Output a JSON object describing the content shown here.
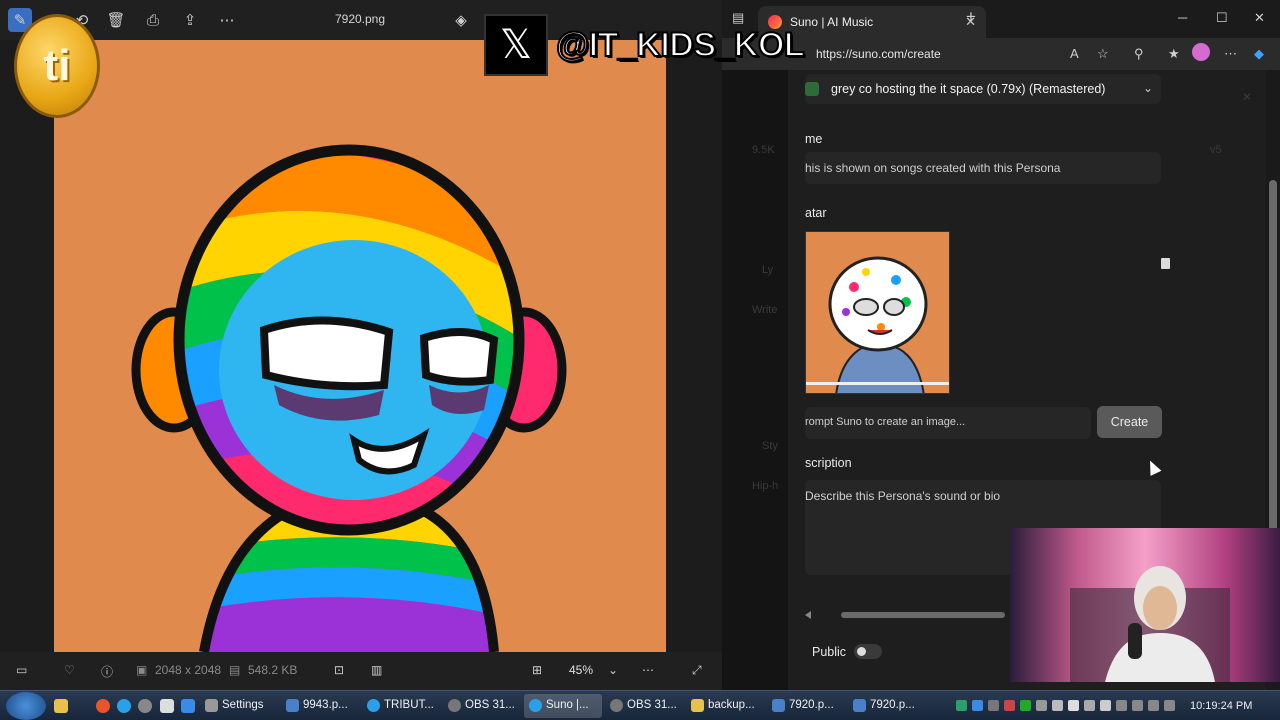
{
  "viewer": {
    "filename": "7920.png",
    "dimensions": "2048 x 2048",
    "filesize": "548.2 KB",
    "zoom": "45%",
    "toolbar_icons": [
      "edit-icon",
      "rotate-icon",
      "delete-icon",
      "print-icon",
      "share-icon",
      "more-icon"
    ]
  },
  "browser": {
    "tab_title": "Suno | AI Music",
    "url": "https://suno.com/create"
  },
  "persona_modal": {
    "song_select": "grey co hosting the it space (0.79x) (Remastered)",
    "name_label": "me",
    "name_placeholder": "his is shown on songs created with this Persona",
    "avatar_label": "atar",
    "image_prompt_placeholder": "rompt Suno to create an image...",
    "create_label": "Create",
    "description_label": "scription",
    "description_placeholder": "Describe this Persona's sound or bio",
    "public_label": "Public"
  },
  "background_page": {
    "count": "9.5K",
    "version": "v5",
    "lyrics_label": "Ly",
    "write_label": "Write",
    "style_label": "Sty",
    "hiphop_label": "Hip-h"
  },
  "overlay": {
    "handle": "@IT_KIDS_KOL",
    "coin_text": "ti"
  },
  "taskbar": {
    "tasks": [
      {
        "label": "Settings",
        "active": false
      },
      {
        "label": "9943.p...",
        "active": false
      },
      {
        "label": "TRIBUT...",
        "active": false
      },
      {
        "label": "OBS 31...",
        "active": false
      },
      {
        "label": "Suno |...",
        "active": true
      },
      {
        "label": "OBS 31...",
        "active": false
      },
      {
        "label": "backup...",
        "active": false
      },
      {
        "label": "7920.p...",
        "active": false
      },
      {
        "label": "7920.p...",
        "active": false
      }
    ],
    "clock": "10:19:24 PM"
  }
}
